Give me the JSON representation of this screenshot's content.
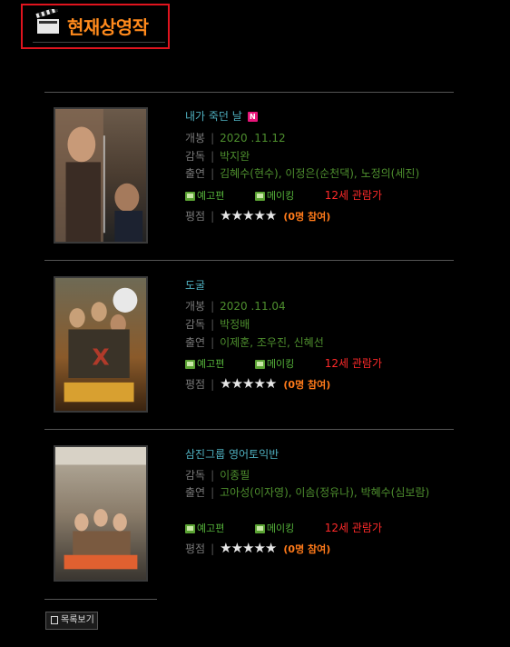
{
  "page": {
    "title": "현재상영작",
    "list_button": "목록보기"
  },
  "labels": {
    "open": "개봉",
    "director": "감독",
    "cast": "출연",
    "rating": "평점",
    "trailer": "예고편",
    "making": "메이킹",
    "sep": "|"
  },
  "colors": {
    "title": "#ff8a1c",
    "movie_title": "#4fb0c0",
    "value": "#4e8f2e",
    "age": "#ff2a2a",
    "votes": "#ff7a1a",
    "highlight_border": "#e0141e"
  },
  "movies": [
    {
      "title": "내가 죽던 날",
      "badge": "N",
      "open": "2020 .11.12",
      "director": "박지완",
      "cast": "김혜수(현수), 이정은(순천댁), 노정의(세진)",
      "age": "12세 관람가",
      "stars": "★★★★★",
      "votes": "(0명 참여)",
      "rating_value": 0
    },
    {
      "title": "도굴",
      "open": "2020 .11.04",
      "director": "박정배",
      "cast": "이제훈, 조우진, 신혜선",
      "age": "12세 관람가",
      "stars": "★★★★★",
      "votes": "(0명 참여)",
      "rating_value": 0
    },
    {
      "title": "삼진그룹 영어토익반",
      "director": "이종필",
      "cast": "고아성(이자영), 이솜(정유나), 박혜수(심보람)",
      "age": "12세 관람가",
      "stars": "★★★★★",
      "votes": "(0명 참여)",
      "rating_value": 0
    }
  ]
}
